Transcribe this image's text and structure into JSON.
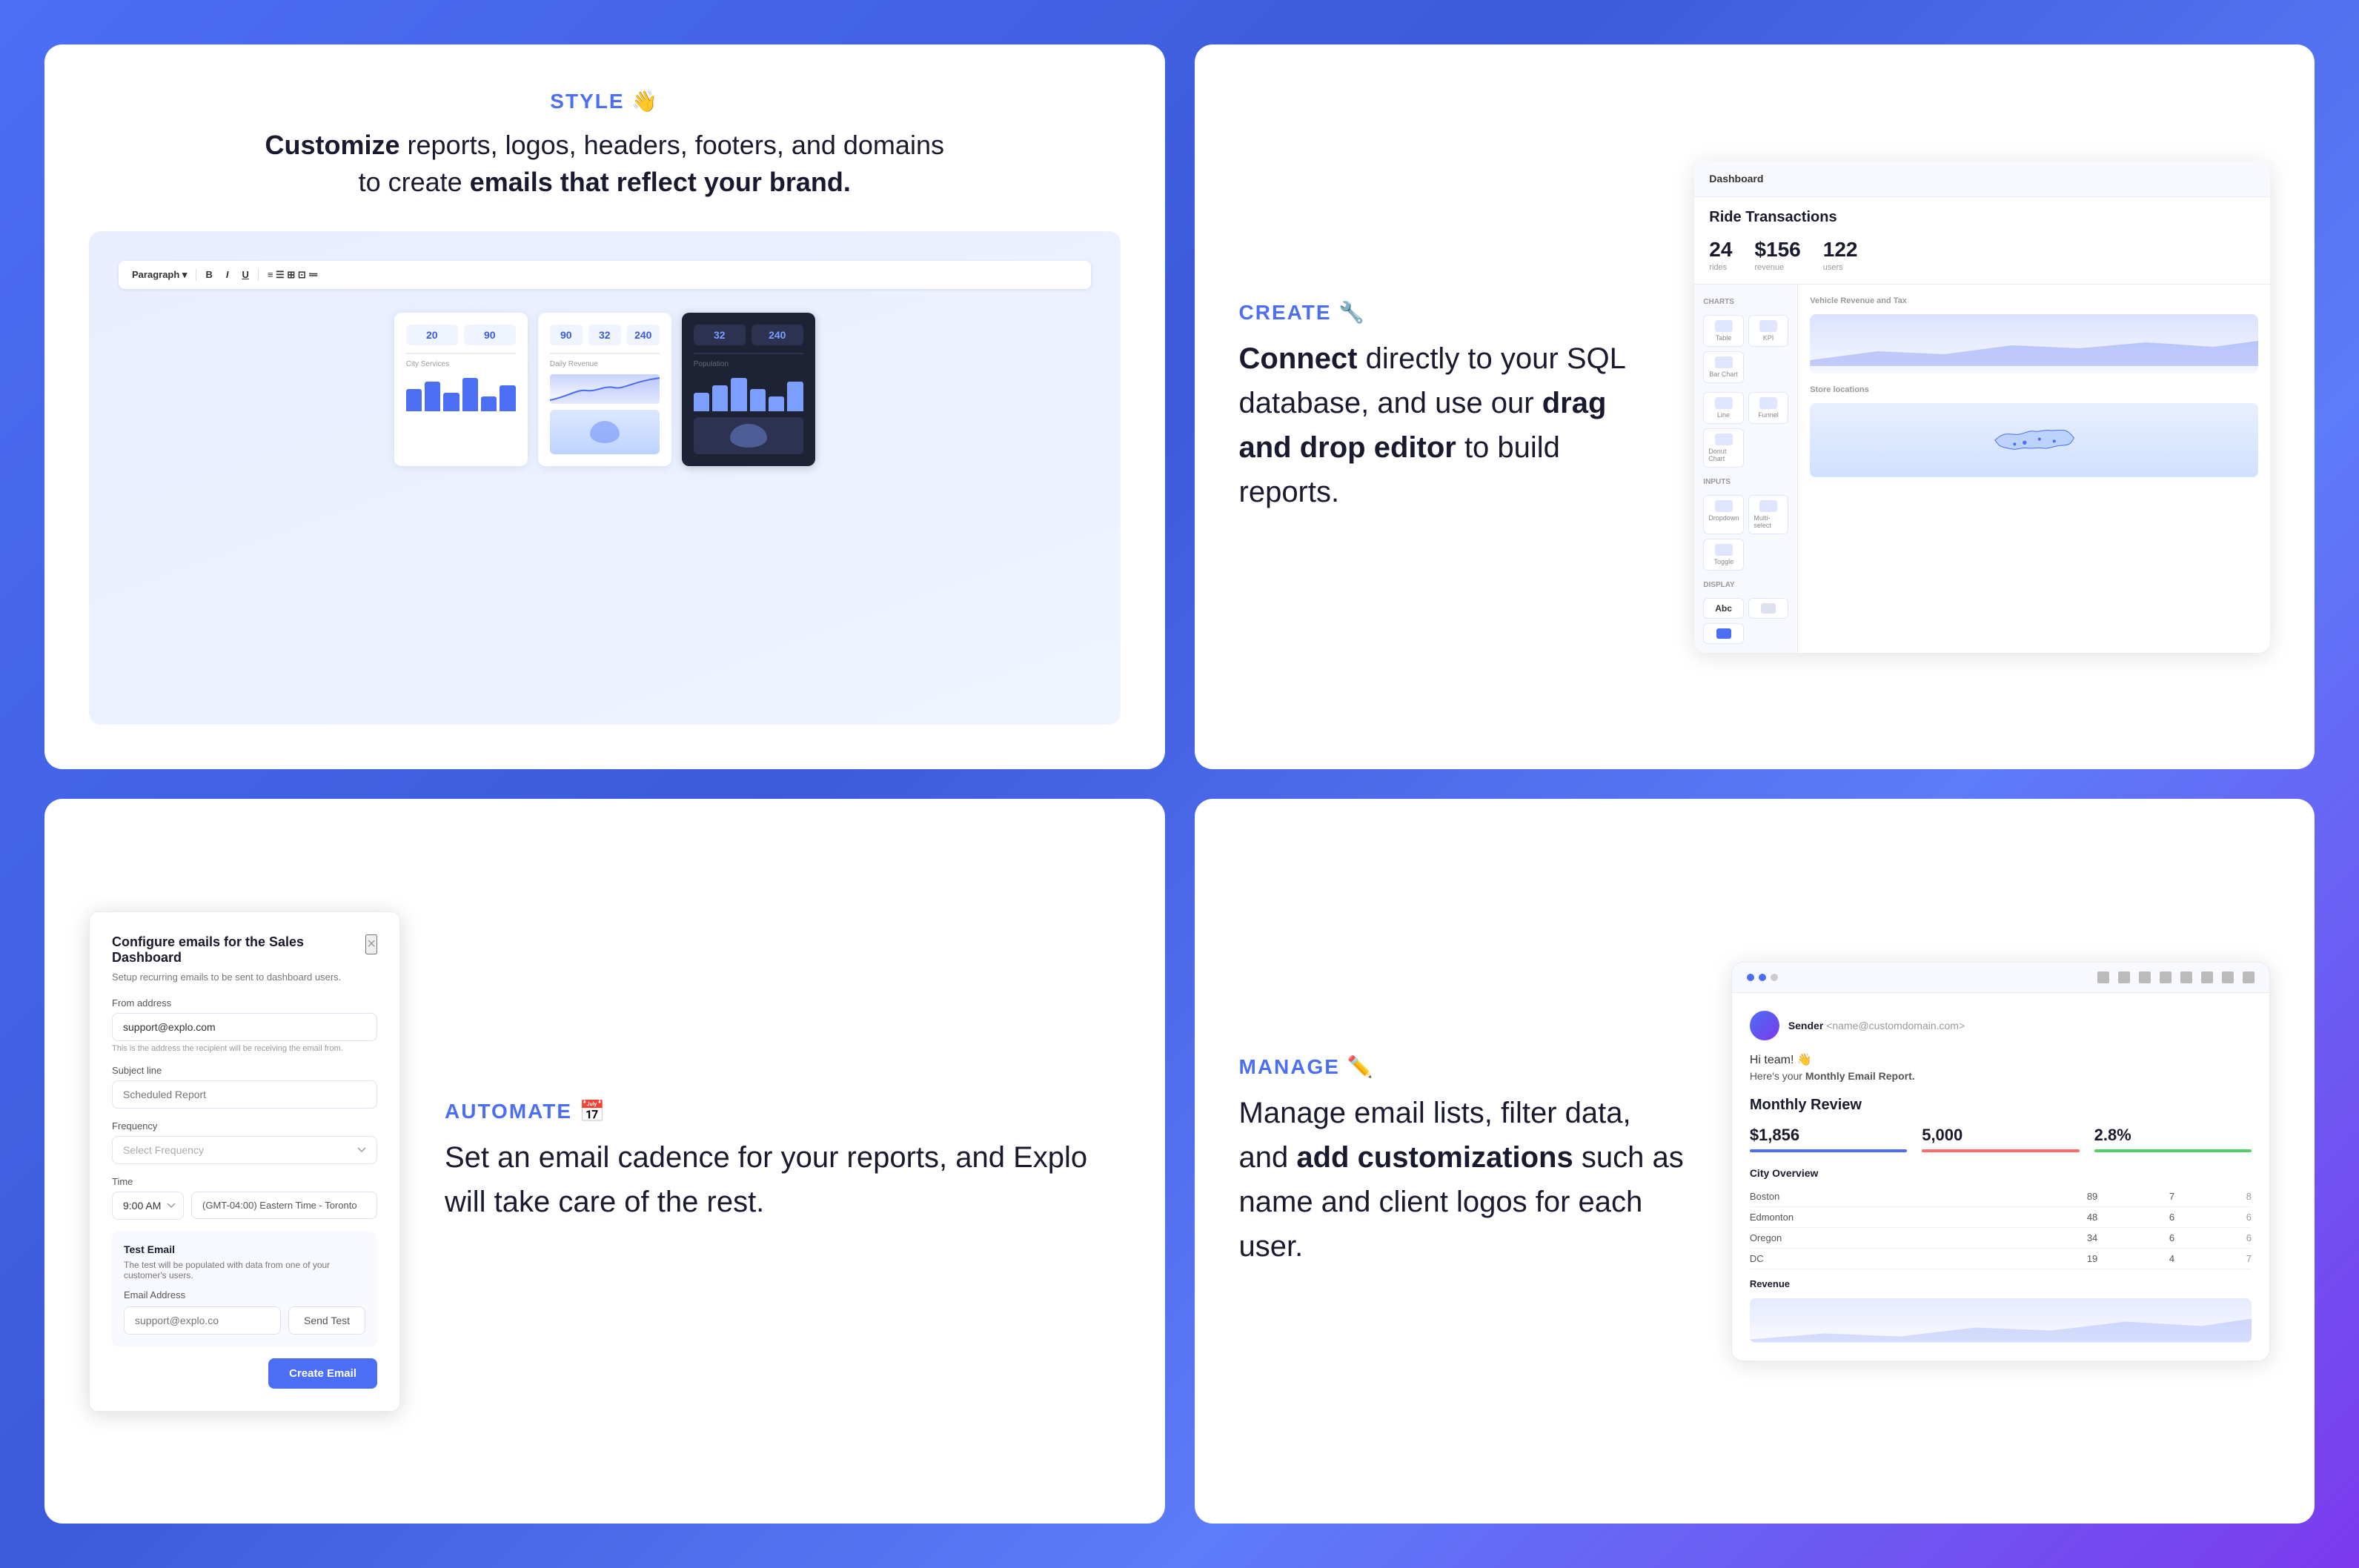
{
  "style_card": {
    "section_label": "STYLE",
    "section_emoji": "👋",
    "heading_part1": "Customize",
    "heading_part2": " reports, logos, headers, footers, and domains",
    "heading_part3": "to create ",
    "heading_bold": "emails that reflect your brand.",
    "stat1": "20",
    "stat2": "90",
    "stat3": "32",
    "stat4": "240"
  },
  "create_card": {
    "section_label": "CREATE",
    "section_emoji": "🔧",
    "heading_part1": "Connect",
    "heading_part2": " directly to your SQL database, and use our ",
    "heading_bold": "drag and drop editor",
    "heading_part3": " to build reports.",
    "dashboard": {
      "nav_item": "Dashboard",
      "title": "Ride Transactions",
      "stat1_num": "24",
      "stat1_label": "rides",
      "stat2_num": "$156",
      "stat2_label": "revenue",
      "stat3_num": "122",
      "stat3_label": "users"
    }
  },
  "automate_card": {
    "section_label": "AUTOMATE",
    "section_emoji": "📅",
    "heading_part1": "Set an email cadence for your reports, and Explo will take care of the rest.",
    "modal": {
      "title": "Configure emails for the Sales Dashboard",
      "subtitle": "Setup recurring emails to be sent to dashboard users.",
      "close": "×",
      "from_label": "From address",
      "from_value": "support@explo.com",
      "from_hint": "This is the address the recipient will be receiving the email from.",
      "subject_label": "Subject line",
      "subject_placeholder": "Scheduled Report",
      "frequency_label": "Frequency",
      "frequency_placeholder": "Select Frequency",
      "time_label": "Time",
      "time_value": "9:00 AM",
      "timezone_value": "(GMT-04:00) Eastern Time - Toronto",
      "test_title": "Test Email",
      "test_desc": "The test will be populated with data from one of your customer's users.",
      "email_label": "Email Address",
      "email_placeholder": "support@explo.co",
      "btn_test": "Send Test",
      "btn_create": "Create Email"
    }
  },
  "manage_card": {
    "section_label": "MANAGE",
    "section_emoji": "✏️",
    "heading_part1": "Manage email lists, filter data,",
    "heading_part2": " and ",
    "heading_bold": "add customizations",
    "heading_part3": " such as name and client logos for each user.",
    "email": {
      "sender_name": "Sender",
      "sender_email": "<name@customdomain.com>",
      "greeting": "Hi team! 👋",
      "message": "Here's your Monthly Email Report.",
      "section": "Monthly Review",
      "metric1_val": "$1,856",
      "metric2_val": "5,000",
      "metric3_val": "2.8%",
      "table_title": "City Overview",
      "rows": [
        {
          "city": "Boston",
          "v1": "89",
          "v2": "7",
          "v3": "8"
        },
        {
          "city": "Edmonton",
          "v1": "48",
          "v2": "6",
          "v3": "6"
        },
        {
          "city": "Oregon",
          "v1": "34",
          "v2": "6",
          "v3": "6"
        },
        {
          "city": "DC",
          "v1": "19",
          "v2": "4",
          "v3": "7"
        }
      ],
      "chart_label": "Revenue"
    }
  }
}
